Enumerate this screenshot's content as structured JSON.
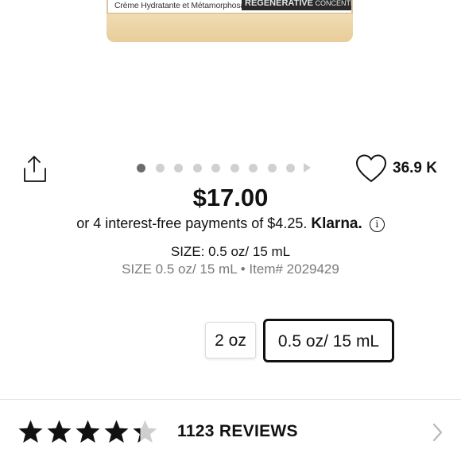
{
  "product": {
    "label_left": "Crème Hydratante et Métamorphosante",
    "label_band_bold": "REGENERATIVE",
    "label_band_rest": "CONCENTRATE"
  },
  "carousel": {
    "dot_count": 9,
    "active_index": 0
  },
  "loves": {
    "count": "36.9 K"
  },
  "pricing": {
    "price": "$17.00",
    "installment_text": "or 4 interest-free payments of $4.25.",
    "provider": "Klarna.",
    "info_glyph": "i"
  },
  "size": {
    "selected_line": "SIZE: 0.5 oz/ 15 mL",
    "size_item_line": "SIZE 0.5 oz/ 15 mL • Item# 2029429",
    "options": [
      {
        "label": "2 oz",
        "selected": false
      },
      {
        "label": "0.5 oz/ 15 mL",
        "selected": true
      }
    ]
  },
  "reviews": {
    "rating": 4.3,
    "max_rating": 5,
    "count_label": "1123 REVIEWS"
  },
  "icons": {
    "share": "share-icon",
    "heart": "heart-icon",
    "play": "play-icon",
    "chevron": "chevron-right-icon"
  }
}
